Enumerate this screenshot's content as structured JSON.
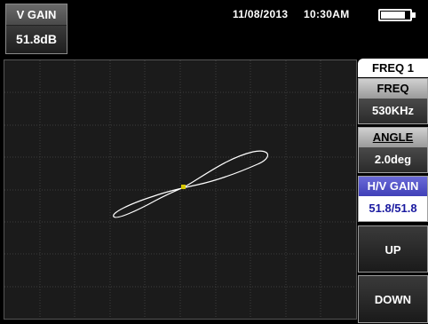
{
  "status": {
    "vgain_label": "V GAIN",
    "vgain_value": "51.8dB",
    "date": "11/08/2013",
    "time": "10:30AM",
    "battery_level": 0.85
  },
  "menu": {
    "tab_label": "FREQ 1",
    "freq_label": "FREQ",
    "freq_value": "530KHz",
    "angle_label": "ANGLE",
    "angle_value": "2.0deg",
    "hvgain_label": "H/V GAIN",
    "hvgain_value": "51.8/51.8",
    "up_label": "UP",
    "down_label": "DOWN"
  },
  "colors": {
    "accent": "#4a4ac8",
    "trace": "#ffffff",
    "grid": "#3c3c3c",
    "dot": "#d8c800"
  }
}
